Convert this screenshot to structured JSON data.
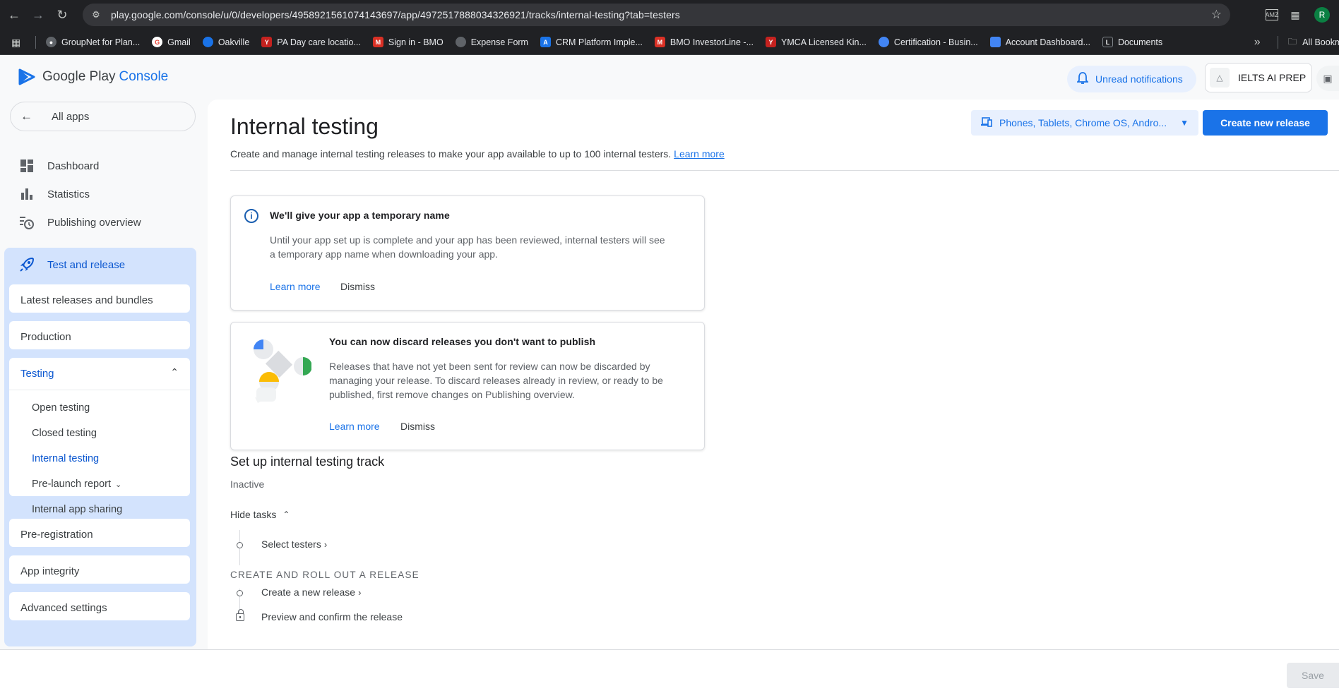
{
  "browser": {
    "url": "play.google.com/console/u/0/developers/4958921561074143697/app/4972517888034326921/tracks/internal-testing?tab=testers",
    "profile_initial": "R",
    "bookmarks": [
      {
        "label": "GroupNet for Plan...",
        "color": "#5f6368"
      },
      {
        "label": "Gmail",
        "color": "#ea4335"
      },
      {
        "label": "Oakville",
        "color": "#1a73e8"
      },
      {
        "label": "PA Day care locatio...",
        "color": "#c5221f"
      },
      {
        "label": "Sign in - BMO",
        "color": "#d93025"
      },
      {
        "label": "Expense Form",
        "color": "#5f6368"
      },
      {
        "label": "CRM Platform Imple...",
        "color": "#1a73e8"
      },
      {
        "label": "BMO InvestorLine -...",
        "color": "#d93025"
      },
      {
        "label": "YMCA Licensed Kin...",
        "color": "#c5221f"
      },
      {
        "label": "Certification - Busin...",
        "color": "#4285f4"
      },
      {
        "label": "Account Dashboard...",
        "color": "#4285f4"
      },
      {
        "label": "Documents",
        "color": "#202124"
      }
    ],
    "more_bookmarks": "»",
    "all_bookmarks": "All Bookmarks"
  },
  "header": {
    "brand_part1": "Google Play",
    "brand_part2": "Console",
    "unread_label": "Unread notifications",
    "app_name": "IELTS AI PREP"
  },
  "sidebar": {
    "all_apps": "All apps",
    "items": [
      {
        "label": "Dashboard",
        "icon": "dashboard-icon"
      },
      {
        "label": "Statistics",
        "icon": "bar-chart-icon"
      },
      {
        "label": "Publishing overview",
        "icon": "history-icon"
      }
    ],
    "group": {
      "label": "Test and release",
      "subitems": [
        "Latest releases and bundles",
        "Production"
      ],
      "testing": {
        "label": "Testing",
        "children": [
          "Open testing",
          "Closed testing",
          "Internal testing",
          "Pre-launch report",
          "Internal app sharing"
        ]
      },
      "after": [
        "Pre-registration",
        "App integrity",
        "Advanced settings"
      ]
    }
  },
  "main": {
    "title": "Internal testing",
    "description": "Create and manage internal testing releases to make your app available to up to 100 internal testers.",
    "learn_more": "Learn more",
    "device_select": "Phones, Tablets, Chrome OS, Andro...",
    "create_button": "Create new release",
    "card1": {
      "title": "We'll give your app a temporary name",
      "body": "Until your app set up is complete and your app has been reviewed, internal testers will see a temporary app name when downloading your app.",
      "learn_more": "Learn more",
      "dismiss": "Dismiss"
    },
    "card2": {
      "title": "You can now discard releases you don't want to publish",
      "body": "Releases that have not yet been sent for review can now be discarded by managing your release. To discard releases already in review, or ready to be published, first remove changes on Publishing overview.",
      "learn_more": "Learn more",
      "dismiss": "Dismiss"
    },
    "setup": {
      "title": "Set up internal testing track",
      "status": "Inactive",
      "hide_tasks": "Hide tasks",
      "task1": "Select testers",
      "section": "CREATE AND ROLL OUT A RELEASE",
      "task2": "Create a new release",
      "task3": "Preview and confirm the release"
    }
  },
  "footer": {
    "save": "Save"
  }
}
